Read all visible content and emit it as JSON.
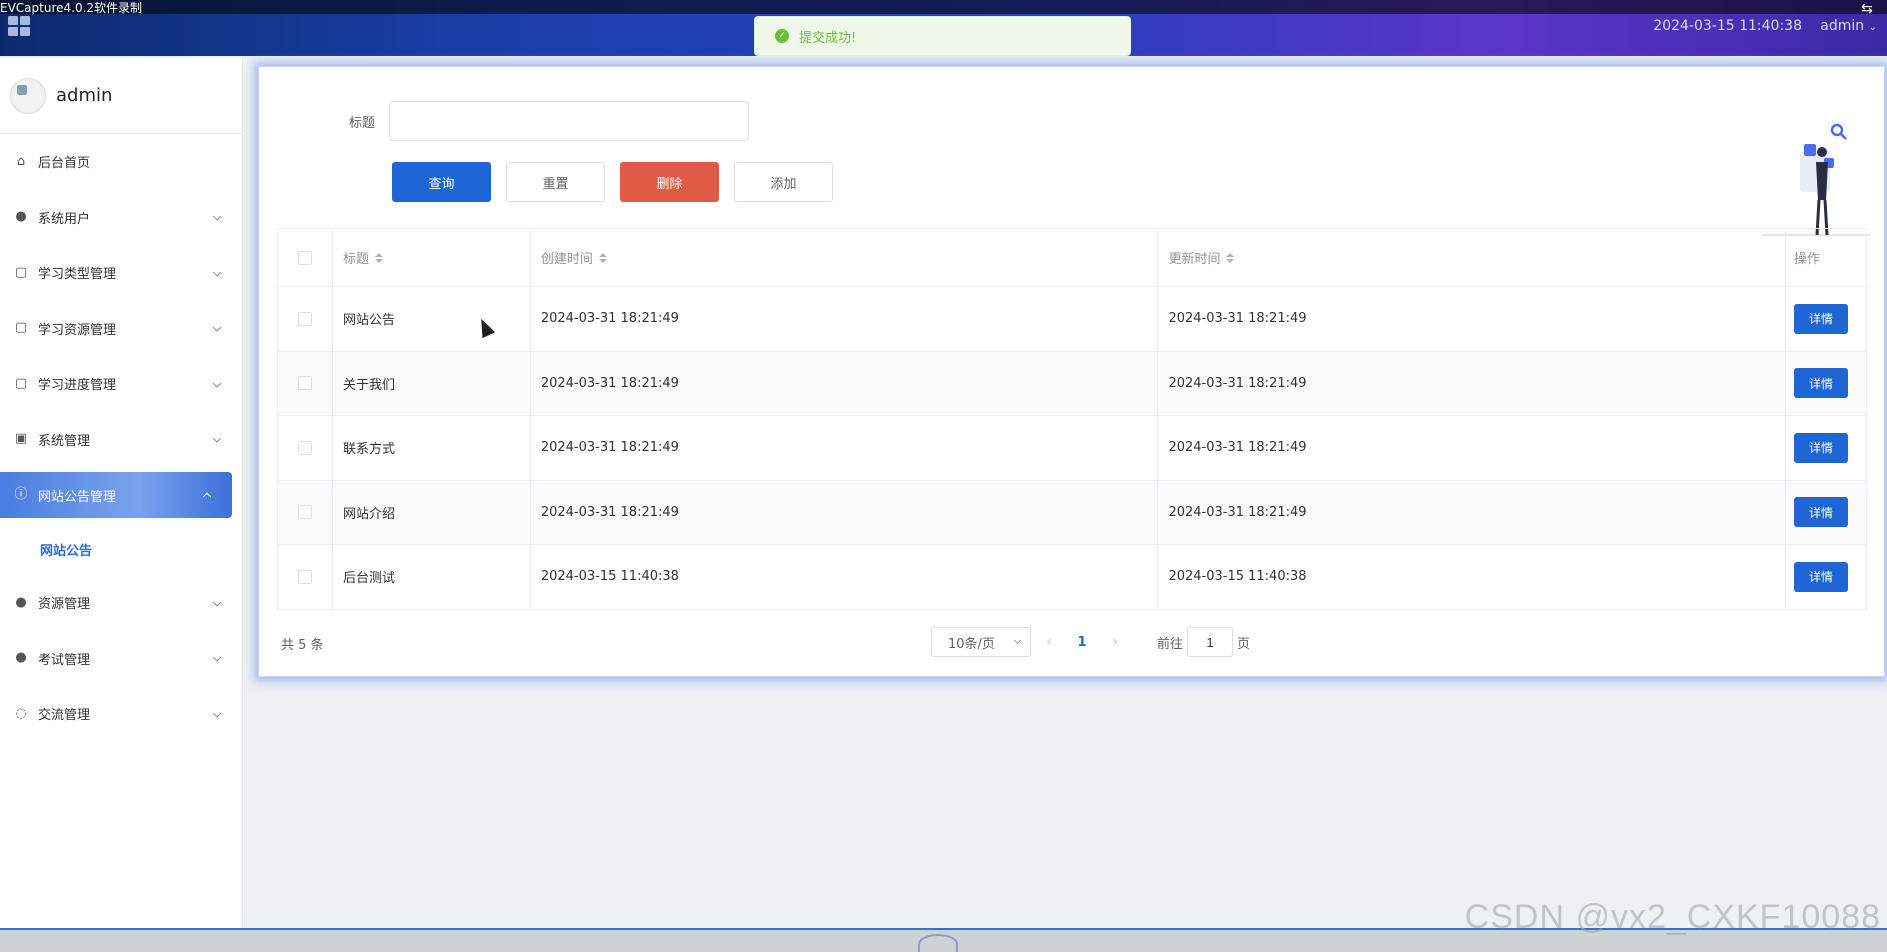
{
  "recorder": {
    "title": "EVCapture4.0.2软件录制"
  },
  "topbar": {
    "datetime": "2024-03-15 11:40:38",
    "user": "admin"
  },
  "toast": {
    "message": "提交成功!"
  },
  "sidebar": {
    "user_name": "admin",
    "items": [
      {
        "label": "后台首页",
        "icon": "home-icon"
      },
      {
        "label": "系统用户",
        "icon": "user-icon"
      },
      {
        "label": "学习类型管理",
        "icon": "tag-icon"
      },
      {
        "label": "学习资源管理",
        "icon": "tag-icon"
      },
      {
        "label": "学习进度管理",
        "icon": "tag-icon"
      },
      {
        "label": "系统管理",
        "icon": "picture-icon"
      },
      {
        "label": "网站公告管理",
        "icon": "info-icon"
      },
      {
        "label": "资源管理",
        "icon": "bulb-icon"
      },
      {
        "label": "考试管理",
        "icon": "bulb-icon"
      },
      {
        "label": "交流管理",
        "icon": "chat-icon"
      }
    ],
    "active_sub": "网站公告"
  },
  "search": {
    "label": "标题",
    "value": ""
  },
  "buttons": {
    "query": "查询",
    "reset": "重置",
    "delete": "删除",
    "add": "添加"
  },
  "table": {
    "headers": {
      "title": "标题",
      "created": "创建时间",
      "updated": "更新时间",
      "op": "操作"
    },
    "rows": [
      {
        "title": "网站公告",
        "created": "2024-03-31 18:21:49",
        "updated": "2024-03-31 18:21:49",
        "action": "详情"
      },
      {
        "title": "关于我们",
        "created": "2024-03-31 18:21:49",
        "updated": "2024-03-31 18:21:49",
        "action": "详情"
      },
      {
        "title": "联系方式",
        "created": "2024-03-31 18:21:49",
        "updated": "2024-03-31 18:21:49",
        "action": "详情"
      },
      {
        "title": "网站介绍",
        "created": "2024-03-31 18:21:49",
        "updated": "2024-03-31 18:21:49",
        "action": "详情"
      },
      {
        "title": "后台测试",
        "created": "2024-03-15 11:40:38",
        "updated": "2024-03-15 11:40:38",
        "action": "详情"
      }
    ]
  },
  "pagination": {
    "total": "共 5 条",
    "page_size": "10条/页",
    "current": "1",
    "goto_prefix": "前往",
    "goto_value": "1",
    "goto_suffix": "页"
  },
  "watermark": "CSDN @vx2_CXKF10088",
  "colors": {
    "primary": "#1e66d6",
    "danger": "#e05a45",
    "success": "#67c23a"
  }
}
